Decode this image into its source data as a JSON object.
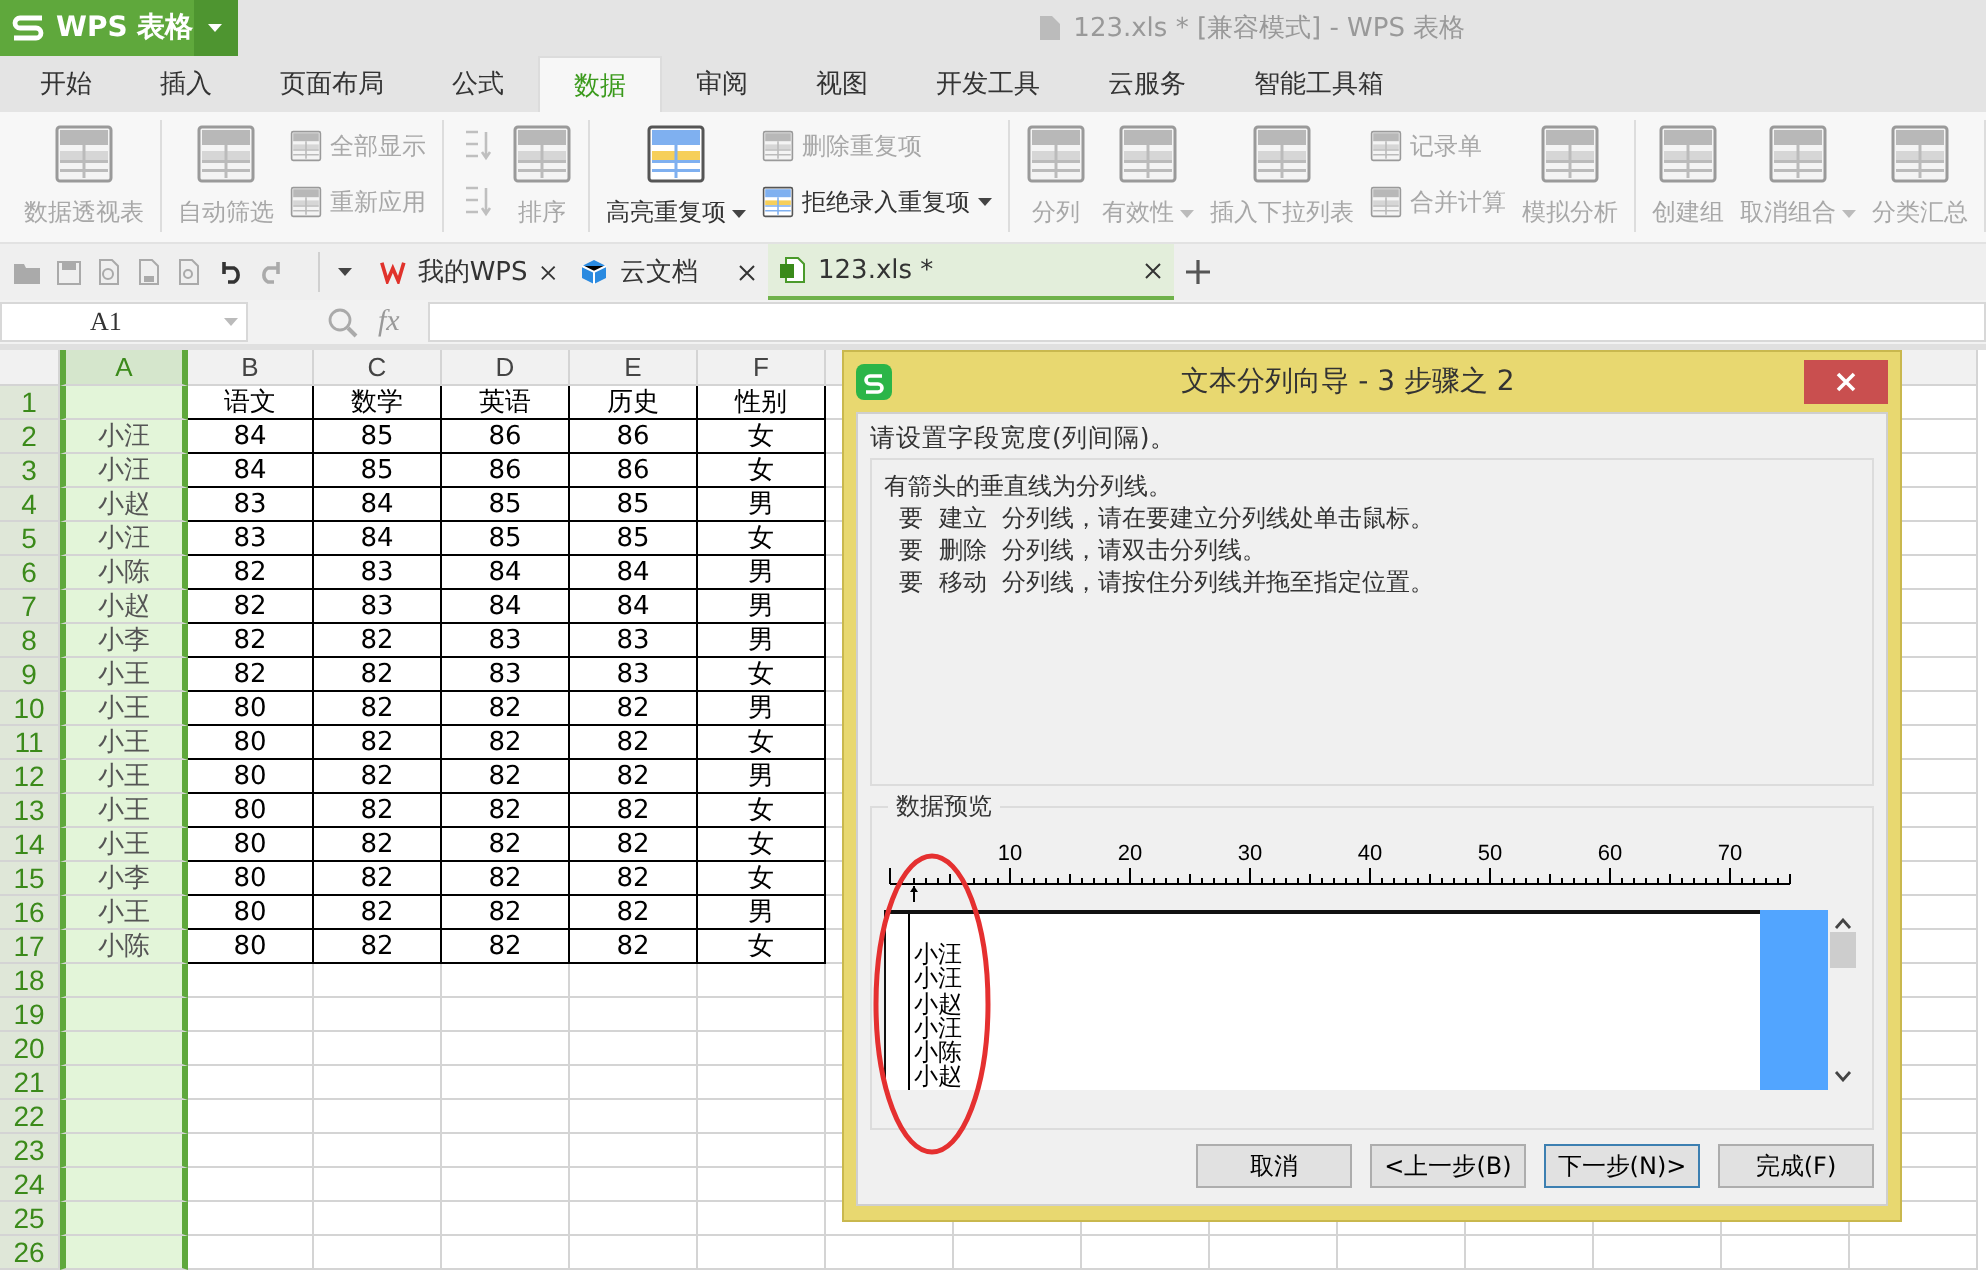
{
  "app_button": {
    "label": "WPS 表格"
  },
  "window": {
    "title": "123.xls * [兼容模式] - WPS 表格"
  },
  "menu_tabs": [
    {
      "label": "开始",
      "selected": false
    },
    {
      "label": "插入",
      "selected": false
    },
    {
      "label": "页面布局",
      "selected": false
    },
    {
      "label": "公式",
      "selected": false
    },
    {
      "label": "数据",
      "selected": true
    },
    {
      "label": "审阅",
      "selected": false
    },
    {
      "label": "视图",
      "selected": false
    },
    {
      "label": "开发工具",
      "selected": false
    },
    {
      "label": "云服务",
      "selected": false
    },
    {
      "label": "智能工具箱",
      "selected": false
    }
  ],
  "ribbon": {
    "groups": [
      {
        "columns": [
          {
            "kind": "large",
            "label": "数据透视表",
            "disabled": true,
            "dropdown": false
          }
        ]
      },
      {
        "columns": [
          {
            "kind": "large",
            "label": "自动筛选",
            "disabled": true,
            "dropdown": false
          },
          {
            "kind": "stack",
            "items": [
              {
                "kind": "small",
                "label": "全部显示",
                "disabled": true,
                "dropdown": false
              },
              {
                "kind": "small",
                "label": "重新应用",
                "disabled": true,
                "dropdown": false
              }
            ]
          }
        ]
      },
      {
        "columns": [
          {
            "kind": "stack",
            "items": [
              {
                "kind": "icon",
                "disabled": true
              },
              {
                "kind": "icon",
                "disabled": true
              }
            ]
          },
          {
            "kind": "large",
            "label": "排序",
            "disabled": true,
            "dropdown": false
          }
        ]
      },
      {
        "columns": [
          {
            "kind": "large",
            "label": "高亮重复项",
            "disabled": false,
            "dropdown": true
          },
          {
            "kind": "stack",
            "items": [
              {
                "kind": "small",
                "label": "删除重复项",
                "disabled": true,
                "dropdown": false
              },
              {
                "kind": "small",
                "label": "拒绝录入重复项",
                "disabled": false,
                "dropdown": true
              }
            ]
          }
        ]
      },
      {
        "columns": [
          {
            "kind": "large",
            "label": "分列",
            "disabled": true,
            "dropdown": false
          },
          {
            "kind": "large",
            "label": "有效性",
            "disabled": true,
            "dropdown": true
          },
          {
            "kind": "large",
            "label": "插入下拉列表",
            "disabled": true,
            "dropdown": false
          },
          {
            "kind": "stack",
            "items": [
              {
                "kind": "small",
                "label": "记录单",
                "disabled": true,
                "dropdown": false
              },
              {
                "kind": "small",
                "label": "合并计算",
                "disabled": true,
                "dropdown": false
              }
            ]
          },
          {
            "kind": "large",
            "label": "模拟分析",
            "disabled": true,
            "dropdown": false
          }
        ]
      },
      {
        "columns": [
          {
            "kind": "large",
            "label": "创建组",
            "disabled": true,
            "dropdown": false
          },
          {
            "kind": "large",
            "label": "取消组合",
            "disabled": true,
            "dropdown": true
          },
          {
            "kind": "large",
            "label": "分类汇总",
            "disabled": true,
            "dropdown": false
          }
        ]
      }
    ]
  },
  "doc_tabs": [
    {
      "label": "我的WPS",
      "selected": false
    },
    {
      "label": "云文档",
      "selected": false
    },
    {
      "label": "123.xls *",
      "selected": true
    }
  ],
  "formula_bar": {
    "name_box": "A1",
    "function_label": "fx"
  },
  "sheet": {
    "columns": [
      {
        "label": "A",
        "selected": true
      },
      {
        "label": "B",
        "selected": false
      },
      {
        "label": "C",
        "selected": false
      },
      {
        "label": "D",
        "selected": false
      },
      {
        "label": "E",
        "selected": false
      },
      {
        "label": "F",
        "selected": false
      }
    ],
    "header_row": {
      "number": "1",
      "cells": [
        "语文",
        "数学",
        "英语",
        "历史",
        "性别"
      ]
    },
    "rows": [
      {
        "number": "2",
        "cells": [
          "小汪",
          "84",
          "85",
          "86",
          "86",
          "女"
        ]
      },
      {
        "number": "3",
        "cells": [
          "小汪",
          "84",
          "85",
          "86",
          "86",
          "女"
        ]
      },
      {
        "number": "4",
        "cells": [
          "小赵",
          "83",
          "84",
          "85",
          "85",
          "男"
        ]
      },
      {
        "number": "5",
        "cells": [
          "小汪",
          "83",
          "84",
          "85",
          "85",
          "女"
        ]
      },
      {
        "number": "6",
        "cells": [
          "小陈",
          "82",
          "83",
          "84",
          "84",
          "男"
        ]
      },
      {
        "number": "7",
        "cells": [
          "小赵",
          "82",
          "83",
          "84",
          "84",
          "男"
        ]
      },
      {
        "number": "8",
        "cells": [
          "小李",
          "82",
          "82",
          "83",
          "83",
          "男"
        ]
      },
      {
        "number": "9",
        "cells": [
          "小王",
          "82",
          "82",
          "83",
          "83",
          "女"
        ]
      },
      {
        "number": "10",
        "cells": [
          "小王",
          "80",
          "82",
          "82",
          "82",
          "男"
        ]
      },
      {
        "number": "11",
        "cells": [
          "小王",
          "80",
          "82",
          "82",
          "82",
          "女"
        ]
      },
      {
        "number": "12",
        "cells": [
          "小王",
          "80",
          "82",
          "82",
          "82",
          "男"
        ]
      },
      {
        "number": "13",
        "cells": [
          "小王",
          "80",
          "82",
          "82",
          "82",
          "女"
        ]
      },
      {
        "number": "14",
        "cells": [
          "小王",
          "80",
          "82",
          "82",
          "82",
          "女"
        ]
      },
      {
        "number": "15",
        "cells": [
          "小李",
          "80",
          "82",
          "82",
          "82",
          "女"
        ]
      },
      {
        "number": "16",
        "cells": [
          "小王",
          "80",
          "82",
          "82",
          "82",
          "男"
        ]
      },
      {
        "number": "17",
        "cells": [
          "小陈",
          "80",
          "82",
          "82",
          "82",
          "女"
        ]
      }
    ],
    "empty_rows": [
      "18",
      "19",
      "20",
      "21",
      "22",
      "23",
      "24",
      "25",
      "26"
    ]
  },
  "dialog": {
    "title": "文本分列向导 - 3 步骤之 2",
    "prompt": "请设置字段宽度(列间隔)。",
    "instructions": [
      "有箭头的垂直线为分列线。",
      "  要  建立  分列线，请在要建立分列线处单击鼠标。",
      "  要  删除  分列线，请双击分列线。",
      "  要  移动  分列线，请按住分列线并拖至指定位置。"
    ],
    "preview": {
      "label": "数据预览",
      "ruler_labels": [
        "10",
        "20",
        "30",
        "40",
        "50",
        "60",
        "70"
      ],
      "lines": [
        "小汪",
        "小汪",
        "小赵",
        "小汪",
        "小陈",
        "小赵"
      ]
    },
    "buttons": [
      {
        "label": "取消",
        "default": false
      },
      {
        "label": "<上一步(B)",
        "default": false
      },
      {
        "label": "下一步(N)>",
        "default": true
      },
      {
        "label": "完成(F)",
        "default": false
      }
    ]
  }
}
